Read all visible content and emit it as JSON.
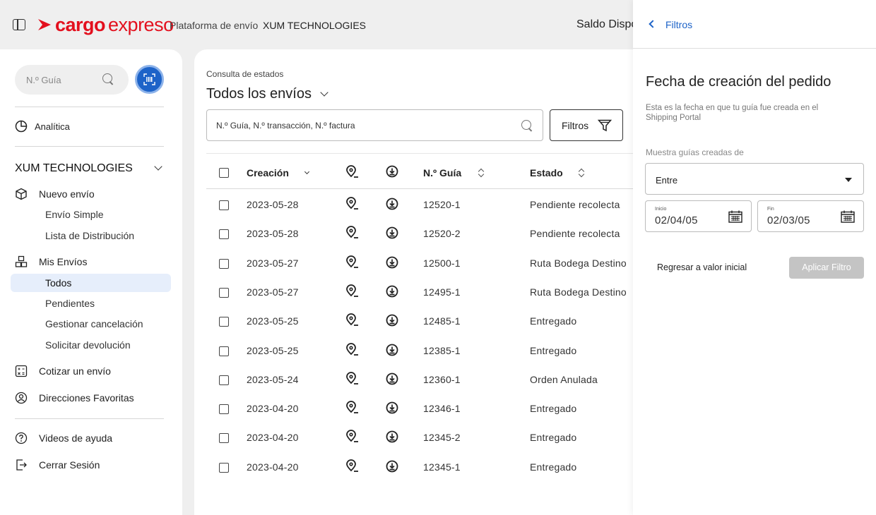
{
  "header": {
    "logo_cargo": "cargo",
    "logo_expreso": "expreso",
    "platform": "Plataforma de envío",
    "company": "XUM TECHNOLOGIES",
    "saldo": "Saldo Dispon"
  },
  "sidebar": {
    "search_placeholder": "N.º Guía",
    "analytics": "Analítica",
    "company": "XUM TECHNOLOGIES",
    "nuevo_envio": "Nuevo envío",
    "envio_simple": "Envío Simple",
    "lista_distribucion": "Lista de Distribución",
    "mis_envios": "Mis Envíos",
    "todos": "Todos",
    "pendientes": "Pendientes",
    "gestionar_cancelacion": "Gestionar cancelación",
    "solicitar_devolucion": "Solicitar devolución",
    "cotizar": "Cotizar un envío",
    "direcciones": "Direcciones Favoritas",
    "videos": "Videos de ayuda",
    "cerrar_sesion": "Cerrar Sesión"
  },
  "main": {
    "breadcrumb": "Consulta de estados",
    "title": "Todos los envíos",
    "search_placeholder": "N.º Guía, N.º transacción, N.º factura",
    "filter_button": "Filtros",
    "columns": {
      "creacion": "Creación",
      "guia": "N.º Guía",
      "estado": "Estado"
    },
    "rows": [
      {
        "fecha": "2023-05-28",
        "guia": "12520-1",
        "estado": "Pendiente recolecta"
      },
      {
        "fecha": "2023-05-28",
        "guia": "12520-2",
        "estado": "Pendiente recolecta"
      },
      {
        "fecha": "2023-05-27",
        "guia": "12500-1",
        "estado": "Ruta Bodega Destino"
      },
      {
        "fecha": "2023-05-27",
        "guia": "12495-1",
        "estado": "Ruta Bodega Destino"
      },
      {
        "fecha": "2023-05-25",
        "guia": "12485-1",
        "estado": "Entregado"
      },
      {
        "fecha": "2023-05-25",
        "guia": "12385-1",
        "estado": "Entregado"
      },
      {
        "fecha": "2023-05-24",
        "guia": "12360-1",
        "estado": "Orden Anulada"
      },
      {
        "fecha": "2023-04-20",
        "guia": "12346-1",
        "estado": "Entregado"
      },
      {
        "fecha": "2023-04-20",
        "guia": "12345-2",
        "estado": "Entregado"
      },
      {
        "fecha": "2023-04-20",
        "guia": "12345-1",
        "estado": "Entregado"
      }
    ]
  },
  "drawer": {
    "back_label": "Filtros",
    "section_title": "Fecha de creación del pedido",
    "description": "Esta es la fecha en que tu guía fue creada en el Shipping Portal",
    "select_label": "Muestra guías creadas de",
    "select_value": "Entre",
    "start_label": "Inicio",
    "start_value": "02/04/05",
    "end_label": "Fin",
    "end_value": "02/03/05",
    "reset": "Regresar a valor inicial",
    "apply": "Aplicar Filtro"
  },
  "colors": {
    "brand_red": "#e3101e",
    "accent_blue": "#1d63c8",
    "active_bg": "#e6eefb",
    "disabled_btn": "#c4c4c4"
  },
  "icons": [
    "sidebar-toggle-icon",
    "logo-arrow-icon",
    "search-icon",
    "barcode-scan-icon",
    "pie-chart-icon",
    "box-icon",
    "boxes-icon",
    "calculator-icon",
    "address-icon",
    "help-icon",
    "logout-icon",
    "filter-icon",
    "sort-icon",
    "location-pin-icon",
    "download-icon",
    "calendar-icon",
    "back-chevron-icon",
    "caret-down-icon"
  ]
}
